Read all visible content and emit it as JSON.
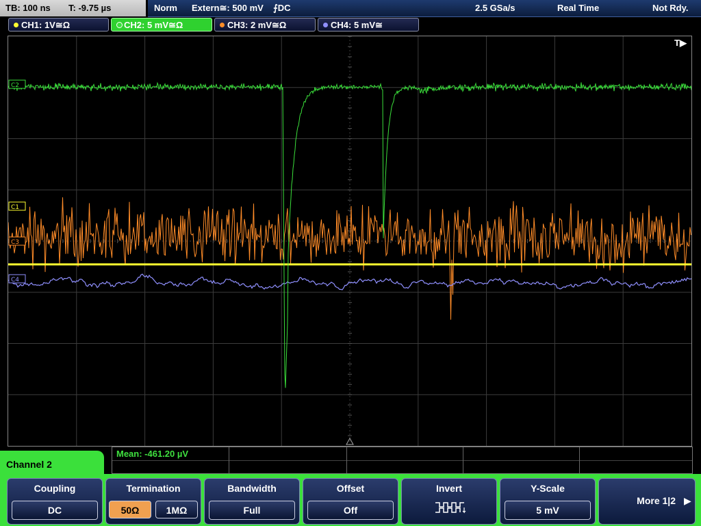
{
  "topbar": {
    "timebase": "TB: 100 ns",
    "trigger_time": "T: -9.75 µs",
    "mode": "Norm",
    "trigger_source": "Extern≅: 500 mV",
    "trigger_slope": "⨍DC",
    "sample_rate": "2.5 GSa/s",
    "acq_mode": "Real Time",
    "status": "Not Rdy."
  },
  "channels": [
    {
      "label": "CH1: 1V≅Ω",
      "color": "#ffff30"
    },
    {
      "label": "CH2: 5 mV≅Ω",
      "color": "#3be03b"
    },
    {
      "label": "CH3: 2 mV≅Ω",
      "color": "#ff8c28"
    },
    {
      "label": "CH4: 5 mV≅",
      "color": "#9090ff"
    }
  ],
  "markers": {
    "c1": "C1",
    "c2": "C2",
    "c3": "C3",
    "c4": "C4",
    "trigger": "T▶"
  },
  "measurement": {
    "mean": "Mean: -461.20 µV"
  },
  "menu": {
    "channel_title": "Channel 2",
    "coupling_label": "Coupling",
    "coupling_value": "DC",
    "termination_label": "Termination",
    "termination_50": "50Ω",
    "termination_1m": "1MΩ",
    "bandwidth_label": "Bandwidth",
    "bandwidth_value": "Full",
    "offset_label": "Offset",
    "offset_value": "Off",
    "invert_label": "Invert",
    "yscale_label": "Y-Scale",
    "yscale_value": "5 mV",
    "more_label": "More 1|2",
    "more_arrow": "▶"
  }
}
